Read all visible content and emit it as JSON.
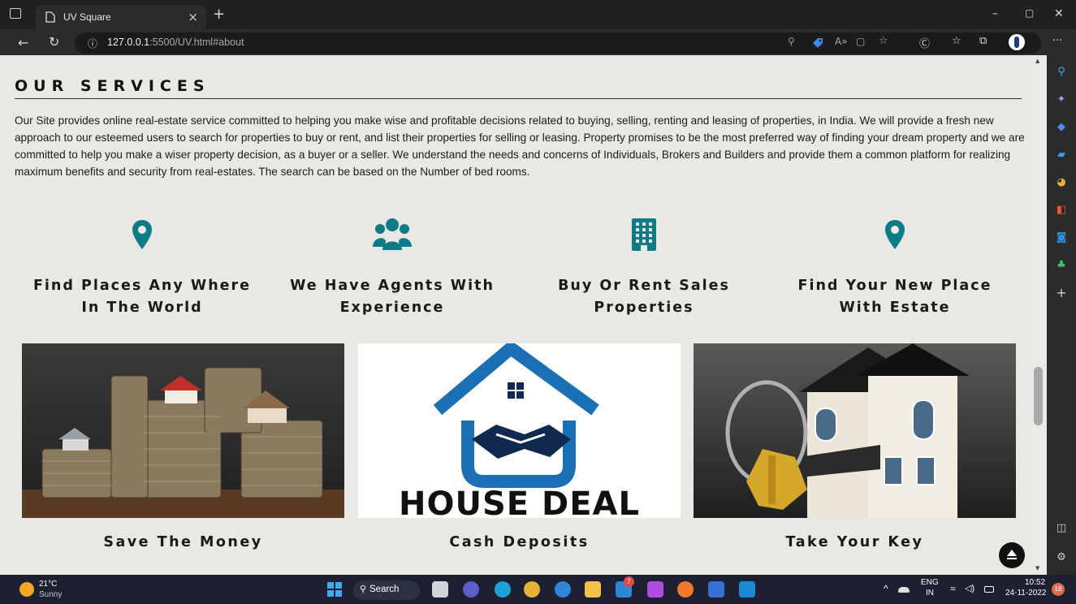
{
  "browser": {
    "tab_title": "UV Square",
    "tab_close": "×",
    "new_tab": "+",
    "url_host": "127.0.0.1",
    "url_rest": ":5500/UV.html#about",
    "window_controls": {
      "minimize": "–",
      "restore": "▢",
      "close": "✕"
    },
    "more_menu": "···",
    "address_icons": [
      "key-icon",
      "tag-icon",
      "read-aloud-icon",
      "immersive-reader-icon",
      "favorite-star-icon",
      "copilot-icon",
      "favorites-icon",
      "collections-icon",
      "profile-icon"
    ]
  },
  "sidebar_icons": [
    "search-icon",
    "copilot-sparkle-icon",
    "shopping-tag-icon",
    "tools-briefcase-icon",
    "games-icon",
    "office-icon",
    "outlook-icon",
    "tree-icon",
    "add-icon",
    "split-screen-icon",
    "settings-icon"
  ],
  "section": {
    "heading": "OUR SERVICES",
    "description": "Our Site provides online real-estate service committed to helping you make wise and profitable decisions related to buying, selling, renting and leasing of properties, in India. We will provide a fresh new approach to our esteemed users to search for properties to buy or rent, and list their properties for selling or leasing. Property promises to be the most preferred way of finding your dream property and we are committed to help you make a wiser property decision, as a buyer or a seller. We understand the needs and concerns of Individuals, Brokers and Builders and provide them a common platform for realizing maximum benefits and security from real-estates. The search can be based on the Number of bed rooms."
  },
  "features": [
    {
      "icon": "map-pin-icon",
      "line1": "Find Places Any Where",
      "line2": "In The World"
    },
    {
      "icon": "users-group-icon",
      "line1": "We Have Agents With",
      "line2": "Experience"
    },
    {
      "icon": "building-icon",
      "line1": "Buy Or Rent Sales",
      "line2": "Properties"
    },
    {
      "icon": "map-pin-icon",
      "line1": "Find Your New Place",
      "line2": "With Estate"
    }
  ],
  "cards": [
    {
      "caption": "Save The Money",
      "image": "houses-on-coins-image"
    },
    {
      "caption": "Cash Deposits",
      "image": "house-deal-logo-image",
      "logo_text": "HOUSE DEAL"
    },
    {
      "caption": "Take Your Key",
      "image": "house-with-keys-image"
    }
  ],
  "colors": {
    "accent": "#0e7c86",
    "page_bg": "#eae8e4",
    "logo_blue": "#1b6fb5",
    "dark_navy": "#0f1a2e"
  },
  "taskbar": {
    "weather_temp": "21°C",
    "weather_desc": "Sunny",
    "search_label": "Search",
    "lang_top": "ENG",
    "lang_bottom": "IN",
    "time": "10:52",
    "date": "24-11-2022",
    "notification_count": "18",
    "chat_badge": "7"
  }
}
